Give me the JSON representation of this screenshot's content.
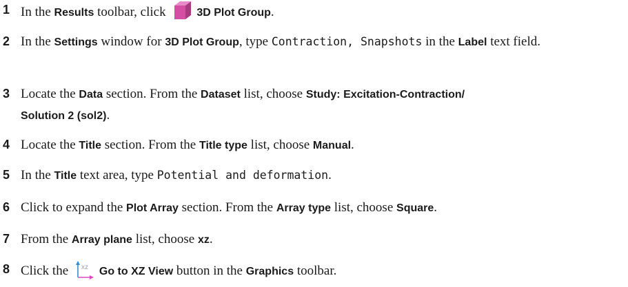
{
  "steps": [
    {
      "num": "1",
      "parts": [
        {
          "t": "In the "
        },
        {
          "t": "Results",
          "s": "b"
        },
        {
          "t": " toolbar, click "
        },
        {
          "icon": "cube-icon"
        },
        {
          "t": "3D Plot Group",
          "s": "b"
        },
        {
          "t": "."
        }
      ]
    },
    {
      "num": "2",
      "parts": [
        {
          "t": "In the "
        },
        {
          "t": "Settings",
          "s": "b"
        },
        {
          "t": " window for "
        },
        {
          "t": "3D Plot Group",
          "s": "b"
        },
        {
          "t": ", type "
        },
        {
          "t": "Contraction, Snapshots",
          "s": "m"
        },
        {
          "t": " in the "
        },
        {
          "t": "Label",
          "s": "b"
        },
        {
          "t": " text field."
        }
      ]
    },
    {
      "num": "3",
      "parts": [
        {
          "t": "Locate the "
        },
        {
          "t": "Data",
          "s": "b"
        },
        {
          "t": " section. From the "
        },
        {
          "t": "Dataset",
          "s": "b"
        },
        {
          "t": " list, choose "
        },
        {
          "t": "Study: Excitation-Contraction/",
          "s": "b"
        },
        {
          "br": true
        },
        {
          "t": "Solution 2 (sol2)",
          "s": "b"
        },
        {
          "t": "."
        }
      ]
    },
    {
      "num": "4",
      "parts": [
        {
          "t": "Locate the "
        },
        {
          "t": "Title",
          "s": "b"
        },
        {
          "t": " section. From the "
        },
        {
          "t": "Title type",
          "s": "b"
        },
        {
          "t": " list, choose "
        },
        {
          "t": "Manual",
          "s": "b"
        },
        {
          "t": "."
        }
      ]
    },
    {
      "num": "5",
      "parts": [
        {
          "t": "In the "
        },
        {
          "t": "Title",
          "s": "b"
        },
        {
          "t": " text area, type "
        },
        {
          "t": "Potential and deformation",
          "s": "m"
        },
        {
          "t": "."
        }
      ]
    },
    {
      "num": "6",
      "parts": [
        {
          "t": "Click to expand the "
        },
        {
          "t": "Plot Array",
          "s": "b"
        },
        {
          "t": " section. From the "
        },
        {
          "t": "Array type",
          "s": "b"
        },
        {
          "t": " list, choose "
        },
        {
          "t": "Square",
          "s": "b"
        },
        {
          "t": "."
        }
      ]
    },
    {
      "num": "7",
      "parts": [
        {
          "t": "From the "
        },
        {
          "t": "Array plane",
          "s": "b"
        },
        {
          "t": " list, choose "
        },
        {
          "t": "xz",
          "s": "b"
        },
        {
          "t": "."
        }
      ]
    },
    {
      "num": "8",
      "parts": [
        {
          "t": "Click the "
        },
        {
          "icon": "xz-view-icon"
        },
        {
          "t": "Go to XZ View",
          "s": "b"
        },
        {
          "t": " button in the "
        },
        {
          "t": "Graphics",
          "s": "b"
        },
        {
          "t": " toolbar."
        }
      ]
    }
  ],
  "icons": {
    "cube-icon": {
      "label": "3D Plot Group icon",
      "colors": [
        "#d44fa3",
        "#e98bc8",
        "#a83a80"
      ]
    },
    "xz-view-icon": {
      "label": "xz",
      "colors": [
        "#2f8fd8",
        "#d84ac0",
        "#9aa3ad"
      ]
    }
  }
}
